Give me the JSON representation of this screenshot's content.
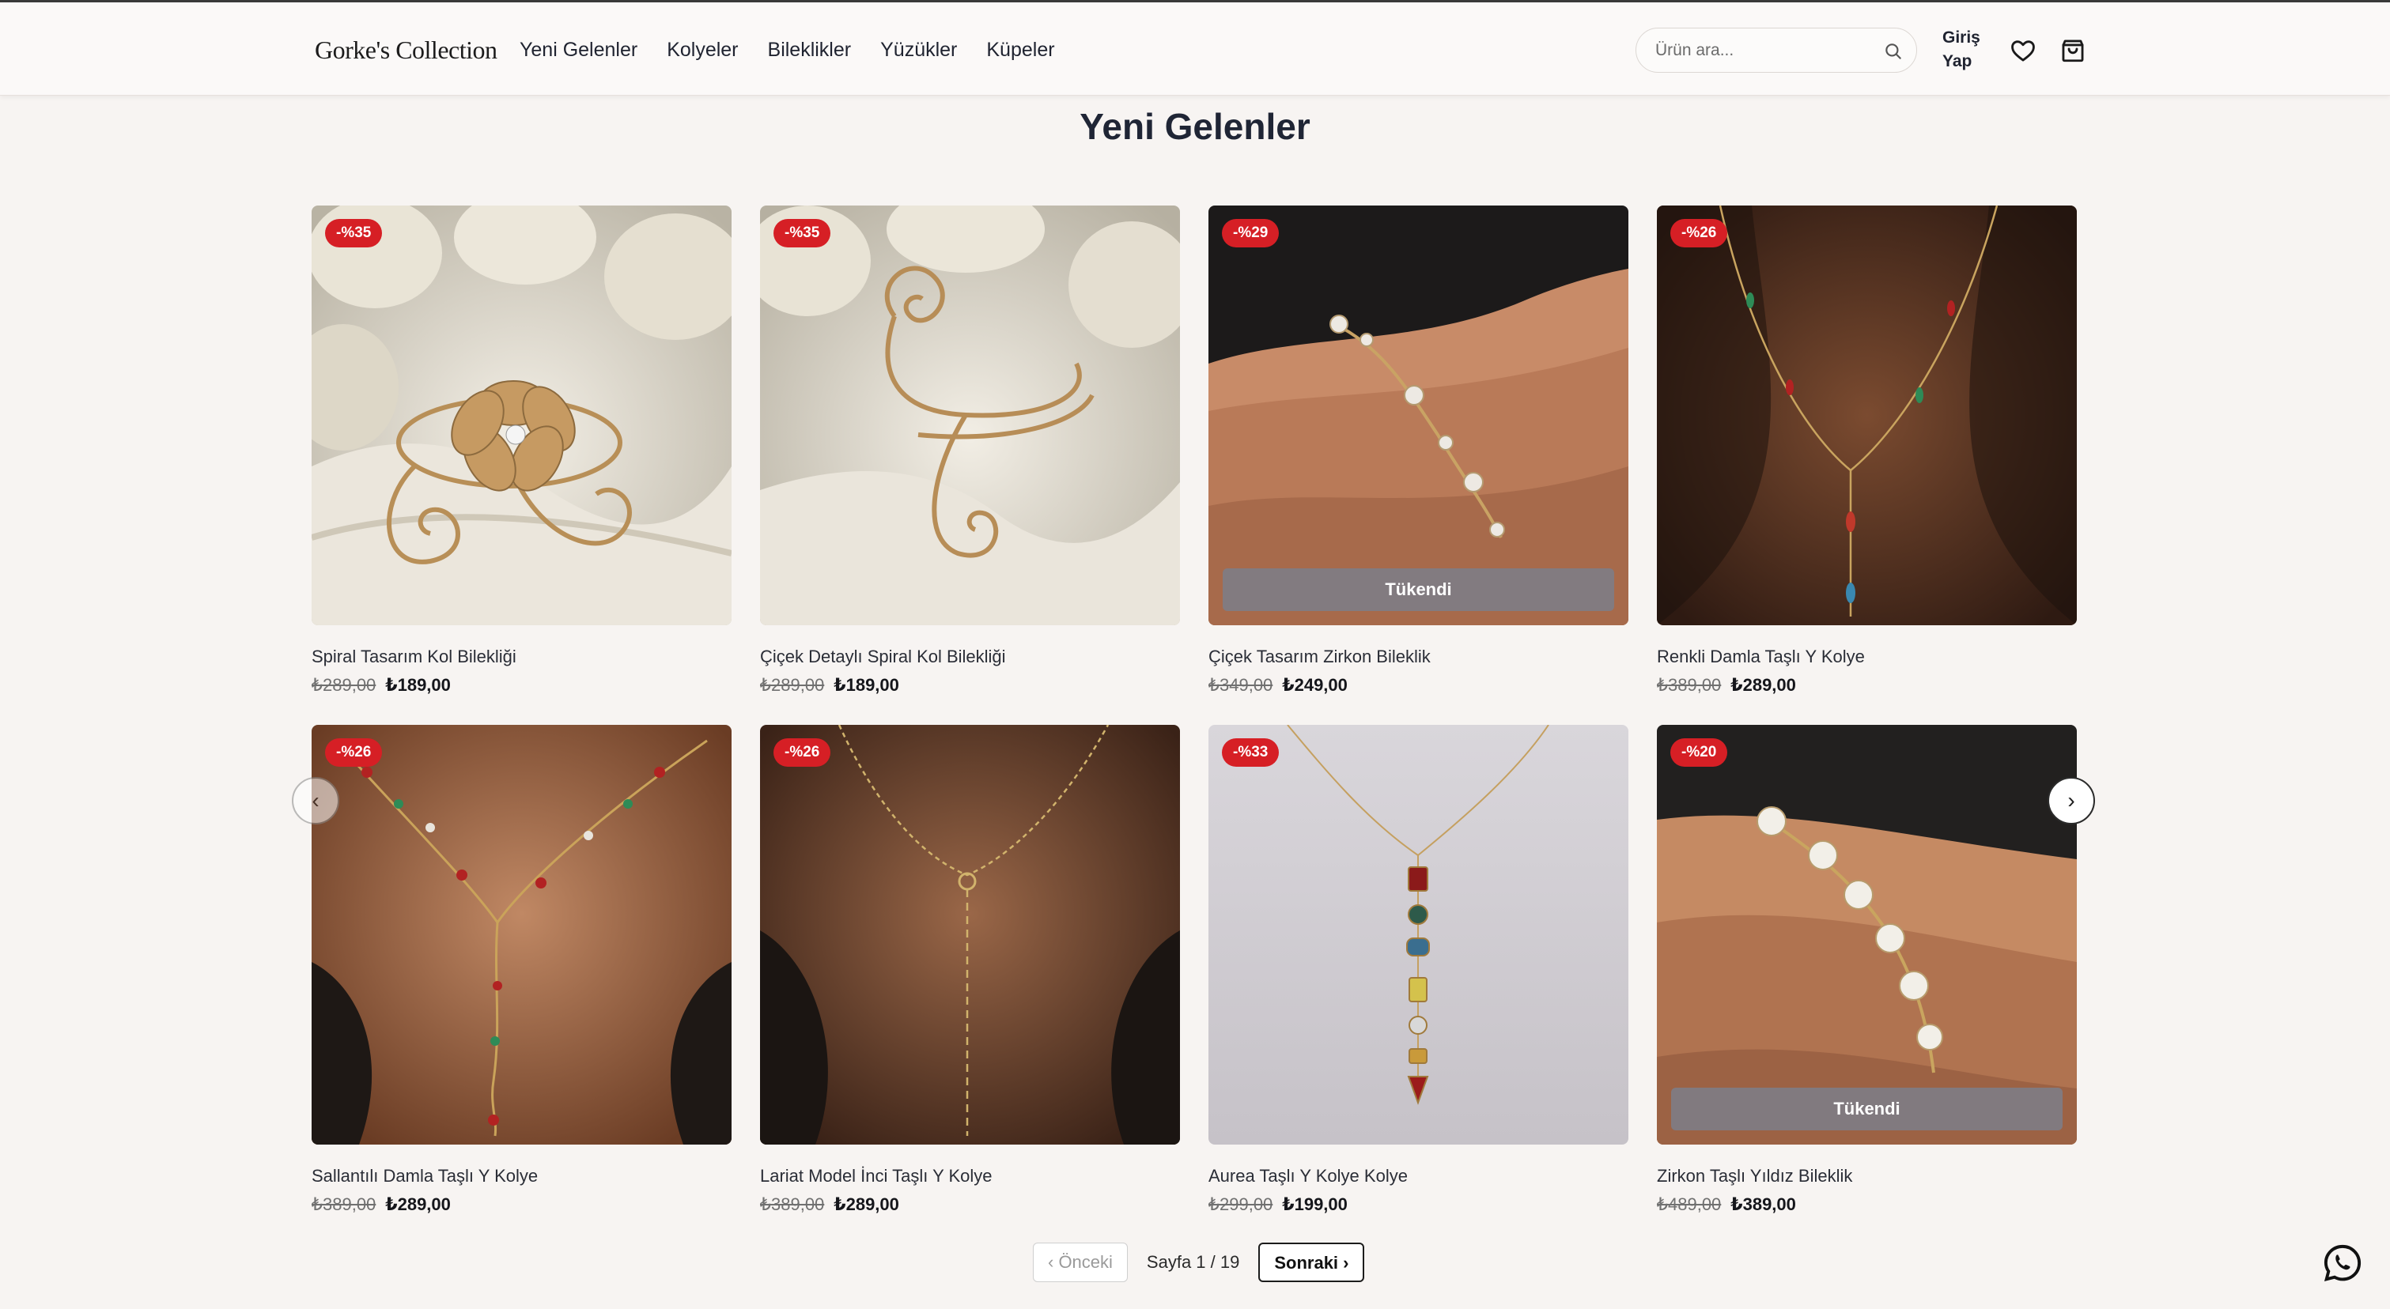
{
  "header": {
    "logo": "Gorke's Collection",
    "nav": [
      "Yeni Gelenler",
      "Kolyeler",
      "Bileklikler",
      "Yüzükler",
      "Küpeler"
    ],
    "search_placeholder": "Ürün ara...",
    "login_line1": "Giriş",
    "login_line2": "Yap",
    "icons": [
      "search-icon",
      "heart-icon",
      "shopping-bag-icon"
    ]
  },
  "page": {
    "title": "Yeni Gelenler"
  },
  "products": [
    {
      "name": "Spiral Tasarım Kol Bilekliği",
      "discount": "-%35",
      "old_price": "₺289,00",
      "price": "₺189,00",
      "sold_out": ""
    },
    {
      "name": "Çiçek Detaylı Spiral Kol Bilekliği",
      "discount": "-%35",
      "old_price": "₺289,00",
      "price": "₺189,00",
      "sold_out": ""
    },
    {
      "name": "Çiçek Tasarım Zirkon Bileklik",
      "discount": "-%29",
      "old_price": "₺349,00",
      "price": "₺249,00",
      "sold_out": "Tükendi"
    },
    {
      "name": "Renkli Damla Taşlı Y Kolye",
      "discount": "-%26",
      "old_price": "₺389,00",
      "price": "₺289,00",
      "sold_out": ""
    },
    {
      "name": "Sallantılı Damla Taşlı Y Kolye",
      "discount": "-%26",
      "old_price": "₺389,00",
      "price": "₺289,00",
      "sold_out": ""
    },
    {
      "name": "Lariat Model İnci Taşlı Y Kolye",
      "discount": "-%26",
      "old_price": "₺389,00",
      "price": "₺289,00",
      "sold_out": ""
    },
    {
      "name": "Aurea Taşlı Y Kolye Kolye",
      "discount": "-%33",
      "old_price": "₺299,00",
      "price": "₺199,00",
      "sold_out": ""
    },
    {
      "name": "Zirkon Taşlı Yıldız Bileklik",
      "discount": "-%20",
      "old_price": "₺489,00",
      "price": "₺389,00",
      "sold_out": "Tükendi"
    }
  ],
  "carousel": {
    "prev": "‹",
    "next": "›"
  },
  "pagination": {
    "prev": "‹ Önceki",
    "info": "Sayfa 1 / 19",
    "next": "Sonraki ›"
  },
  "colors": {
    "accent_badge": "#d61f25",
    "background": "#f7f4f2",
    "header": "#fbf9f8"
  }
}
